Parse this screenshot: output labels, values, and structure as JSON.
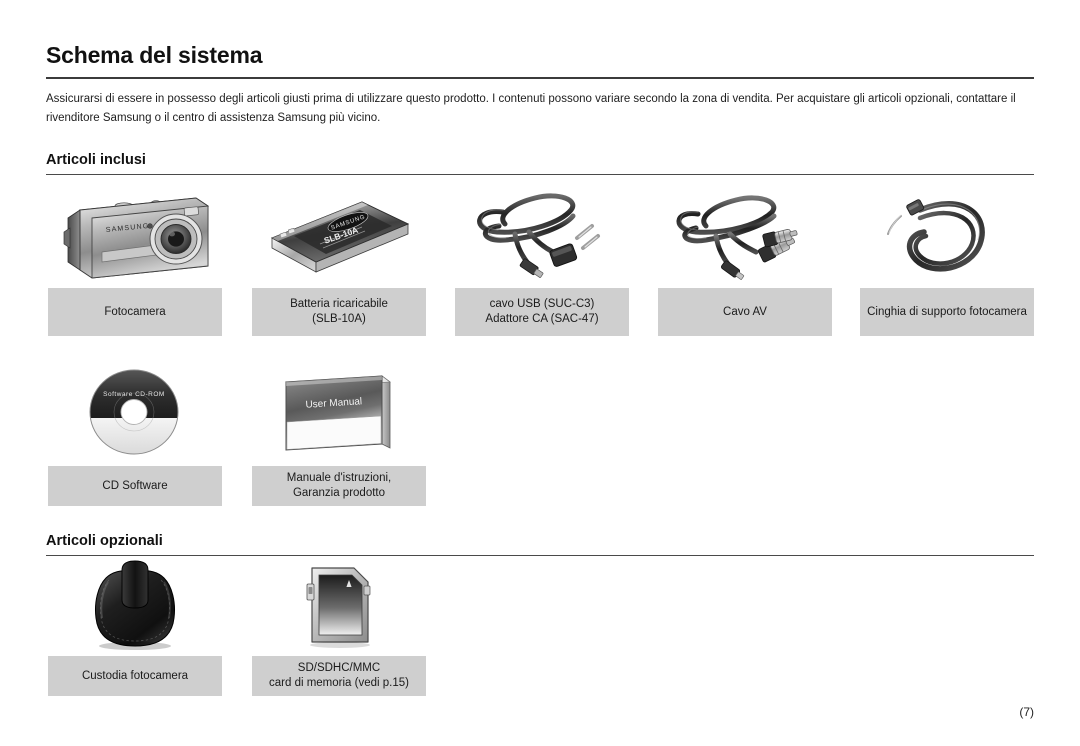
{
  "document": {
    "title": "Schema del sistema",
    "intro": "Assicurarsi di essere in possesso degli articoli giusti prima di utilizzare questo prodotto.  I contenuti possono variare secondo la zona di vendita.  Per acquistare gli articoli opzionali, contattare il rivenditore Samsung o il centro di assistenza Samsung più vicino.",
    "folio": "(7)"
  },
  "sections": {
    "included": {
      "heading": "Articoli inclusi",
      "items": [
        {
          "icon": "digital-camera",
          "label_line1": "Fotocamera",
          "label_line2": ""
        },
        {
          "icon": "rechargeable-battery",
          "label_line1": "Batteria ricaricabile",
          "label_line2": "(SLB-10A)"
        },
        {
          "icon": "usb-cable-ac-adapter",
          "label_line1": "cavo USB  (SUC-C3)",
          "label_line2": "Adattore CA (SAC-47)"
        },
        {
          "icon": "av-cable",
          "label_line1": "Cavo AV",
          "label_line2": ""
        },
        {
          "icon": "camera-strap",
          "label_line1": "Cinghia di supporto fotocamera",
          "label_line2": ""
        },
        {
          "icon": "software-cd",
          "label_line1": "CD Software",
          "label_line2": ""
        },
        {
          "icon": "user-manual-booklet",
          "label_line1": "Manuale d'istruzioni,",
          "label_line2": "Garanzia prodotto"
        }
      ]
    },
    "optional": {
      "heading": "Articoli opzionali",
      "items": [
        {
          "icon": "camera-case",
          "label_line1": "Custodia fotocamera",
          "label_line2": ""
        },
        {
          "icon": "memory-card",
          "label_line1": "SD/SDHC/MMC",
          "label_line2": "card di memoria  (vedi  p.15)"
        }
      ]
    }
  },
  "artwork_text": {
    "cd_label": "Software CD-ROM",
    "manual_cover": "User Manual",
    "battery_brand": "SAMSUNG",
    "battery_model": "SLB-10A"
  },
  "colors": {
    "label_background": "#cfcfcf",
    "rule": "#3b3b3b",
    "text": "#1a1a1a",
    "page_background": "#ffffff"
  }
}
